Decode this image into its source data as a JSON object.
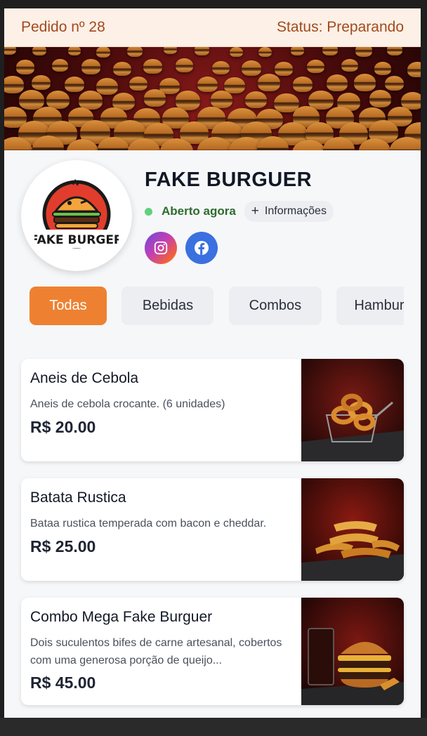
{
  "order_bar": {
    "order_label": "Pedido nº 28",
    "status_label": "Status: Preparando"
  },
  "store": {
    "name": "FAKE BURGUER",
    "logo_text": "FAKE BURGER",
    "open_status": "Aberto agora",
    "info_label": "Informações",
    "social": [
      "instagram-icon",
      "facebook-icon"
    ]
  },
  "tabs": [
    {
      "label": "Todas",
      "active": true
    },
    {
      "label": "Bebidas",
      "active": false
    },
    {
      "label": "Combos",
      "active": false
    },
    {
      "label": "Hamburgueres",
      "active": false
    }
  ],
  "products": [
    {
      "title": "Aneis de Cebola",
      "description": "Aneis de cebola crocante. (6 unidades)",
      "price": "R$ 20.00"
    },
    {
      "title": "Batata Rustica",
      "description": "Bataa rustica temperada com bacon e cheddar.",
      "price": "R$ 25.00"
    },
    {
      "title": "Combo Mega Fake Burguer",
      "description": "Dois suculentos bifes de carne artesanal, cobertos com uma generosa porção de queijo...",
      "price": "R$ 45.00"
    }
  ],
  "colors": {
    "accent": "#ee8131",
    "open_dot": "#5fd07d",
    "order_text": "#a24a1d"
  }
}
